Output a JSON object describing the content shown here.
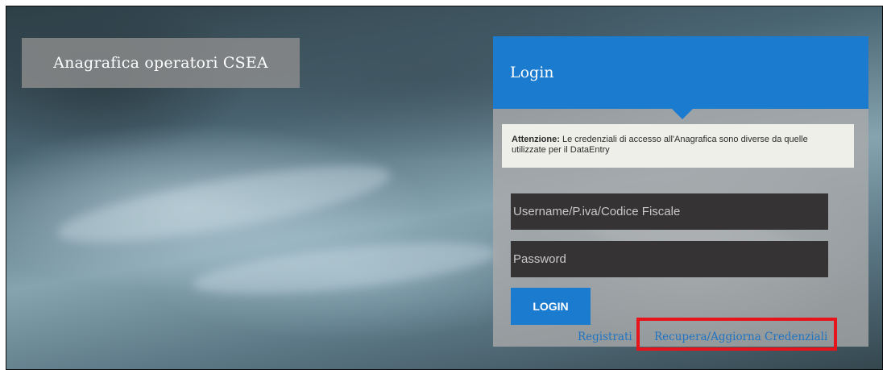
{
  "header": {
    "title": "Anagrafica operatori CSEA"
  },
  "login": {
    "title": "Login",
    "notice_label": "Attenzione:",
    "notice_text": " Le credenziali di accesso all'Anagrafica sono diverse da quelle utilizzate per il DataEntry",
    "username_placeholder": "Username/P.iva/Codice Fiscale",
    "password_placeholder": "Password",
    "button_label": "LOGIN",
    "register_link": "Registrati",
    "recover_link": "Recupera/Aggiorna Credenziali"
  },
  "colors": {
    "accent": "#1a7bcf",
    "highlight": "#e8141b",
    "input_bg": "#353333"
  }
}
